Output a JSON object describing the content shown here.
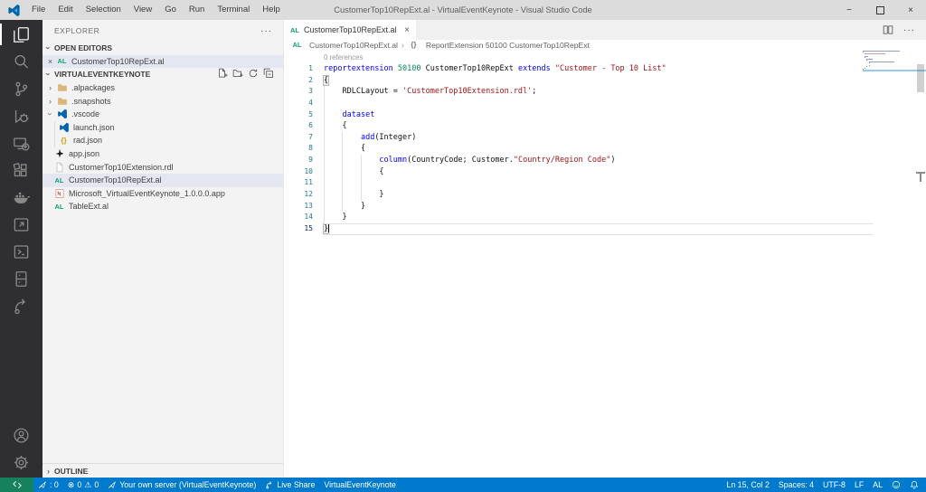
{
  "window": {
    "title": "CustomerTop10RepExt.al - VirtualEventKeynote - Visual Studio Code",
    "controls": {
      "minimize": "−",
      "maximize": "",
      "close": "×"
    }
  },
  "menu": {
    "items": [
      "File",
      "Edit",
      "Selection",
      "View",
      "Go",
      "Run",
      "Terminal",
      "Help"
    ]
  },
  "activity_bar": {
    "active": "explorer",
    "top": [
      "explorer",
      "search",
      "source-control",
      "run-and-debug",
      "remote-monitor",
      "extensions",
      "docker",
      "window-arrow",
      "terminal",
      "storage",
      "live-share"
    ],
    "bottom": [
      "account",
      "settings"
    ]
  },
  "sidebar": {
    "title": "EXPLORER",
    "more_actions": "···",
    "sections": {
      "open_editors": "OPEN EDITORS",
      "workspace": "VIRTUALEVENTKEYNOTE",
      "outline": "OUTLINE"
    },
    "open_editor_items": [
      {
        "icon": "al",
        "label": "CustomerTop10RepExt.al",
        "selected": true,
        "close": "×"
      }
    ],
    "workspace_actions": [
      "new-file",
      "new-folder",
      "refresh-explorer",
      "collapse-folders"
    ],
    "files": [
      {
        "type": "folder",
        "collapsed": true,
        "icon": "folder",
        "label": ".alpackages",
        "level": 1
      },
      {
        "type": "folder",
        "collapsed": true,
        "icon": "folder",
        "label": ".snapshots",
        "level": 1
      },
      {
        "type": "folder",
        "collapsed": false,
        "icon": "vscode",
        "label": ".vscode",
        "level": 1
      },
      {
        "type": "file",
        "icon": "vscode",
        "label": "launch.json",
        "level": 2
      },
      {
        "type": "file",
        "icon": "braces",
        "label": "rad.json",
        "level": 2
      },
      {
        "type": "file",
        "icon": "tool",
        "label": "app.json",
        "level": 1
      },
      {
        "type": "file",
        "icon": "file",
        "label": "CustomerTop10Extension.rdl",
        "level": 1
      },
      {
        "type": "file",
        "icon": "al",
        "label": "CustomerTop10RepExt.al",
        "level": 1,
        "selected": true
      },
      {
        "type": "file",
        "icon": "app-package",
        "label": "Microsoft_VirtualEventKeynote_1.0.0.0.app",
        "level": 1
      },
      {
        "type": "file",
        "icon": "al",
        "label": "TableExt.al",
        "level": 1
      }
    ]
  },
  "editor": {
    "tab": {
      "icon": "al",
      "label": "CustomerTop10RepExt.al",
      "close": "×"
    },
    "breadcrumb": {
      "separator": "›",
      "segments": [
        {
          "icon": "al",
          "label": "CustomerTop10RepExt.al"
        },
        {
          "icon": "braces-gray",
          "label": "ReportExtension 50100 CustomerTop10RepExt"
        }
      ]
    },
    "codelens": "0 references",
    "cursor": {
      "line": 15,
      "col": 2
    },
    "lines": [
      {
        "n": 1,
        "tokens": [
          [
            "kw",
            "reportextension"
          ],
          [
            "pl",
            " "
          ],
          [
            "num",
            "50100"
          ],
          [
            "pl",
            " CustomerTop10RepExt "
          ],
          [
            "kw",
            "extends"
          ],
          [
            "pl",
            " "
          ],
          [
            "str",
            "\"Customer - Top 10 List\""
          ]
        ]
      },
      {
        "n": 2,
        "tokens": [
          [
            "br",
            "{"
          ]
        ]
      },
      {
        "n": 3,
        "tokens": [
          [
            "pl",
            "    RDLCLayout = "
          ],
          [
            "str",
            "'CustomerTop10Extension.rdl'"
          ],
          [
            "pl",
            ";"
          ]
        ]
      },
      {
        "n": 4,
        "tokens": []
      },
      {
        "n": 5,
        "tokens": [
          [
            "pl",
            "    "
          ],
          [
            "kw",
            "dataset"
          ]
        ]
      },
      {
        "n": 6,
        "tokens": [
          [
            "pl",
            "    {"
          ]
        ]
      },
      {
        "n": 7,
        "tokens": [
          [
            "pl",
            "        "
          ],
          [
            "kw",
            "add"
          ],
          [
            "pl",
            "(Integer)"
          ]
        ]
      },
      {
        "n": 8,
        "tokens": [
          [
            "pl",
            "        {"
          ]
        ]
      },
      {
        "n": 9,
        "tokens": [
          [
            "pl",
            "            "
          ],
          [
            "kw",
            "column"
          ],
          [
            "pl",
            "(CountryCode; Customer."
          ],
          [
            "str",
            "\"Country/Region Code\""
          ],
          [
            "pl",
            ")"
          ]
        ]
      },
      {
        "n": 10,
        "tokens": [
          [
            "pl",
            "            {"
          ]
        ]
      },
      {
        "n": 11,
        "tokens": []
      },
      {
        "n": 12,
        "tokens": [
          [
            "pl",
            "            }"
          ]
        ]
      },
      {
        "n": 13,
        "tokens": [
          [
            "pl",
            "        }"
          ]
        ]
      },
      {
        "n": 14,
        "tokens": [
          [
            "pl",
            "    }"
          ]
        ]
      },
      {
        "n": 15,
        "tokens": [
          [
            "br",
            "}"
          ]
        ]
      }
    ]
  },
  "status_bar": {
    "left": [
      {
        "name": "al-counter",
        "icon": "rocket",
        "label": ": 0"
      },
      {
        "name": "problems",
        "icon": "problems",
        "errors": "0",
        "warnings": "0"
      },
      {
        "name": "al-server",
        "icon": "rocket",
        "label": "Your own server (VirtualEventKeynote)"
      },
      {
        "name": "live-share",
        "icon": "share",
        "label": "Live Share"
      },
      {
        "name": "workspace-name",
        "icon": "",
        "label": "VirtualEventKeynote"
      }
    ],
    "right": [
      {
        "name": "cursor-position",
        "icon": "",
        "label": "Ln 15, Col 2"
      },
      {
        "name": "indentation",
        "icon": "",
        "label": "Spaces: 4"
      },
      {
        "name": "encoding",
        "icon": "",
        "label": "UTF-8"
      },
      {
        "name": "eol",
        "icon": "",
        "label": "LF"
      },
      {
        "name": "language-mode",
        "icon": "",
        "label": "AL"
      },
      {
        "name": "feedback",
        "icon": "feedback",
        "label": ""
      },
      {
        "name": "notifications",
        "icon": "bell",
        "label": ""
      }
    ]
  },
  "colors": {
    "status_bar": "#007acc",
    "remote_indicator": "#16825d",
    "keyword": "#0000ff",
    "string": "#a31515",
    "number": "#098658",
    "al_icon": "#0fa36e",
    "selection_bg": "#e4e6f1",
    "activity_bar": "#2f2f32",
    "titlebar": "#dcdcdc"
  }
}
